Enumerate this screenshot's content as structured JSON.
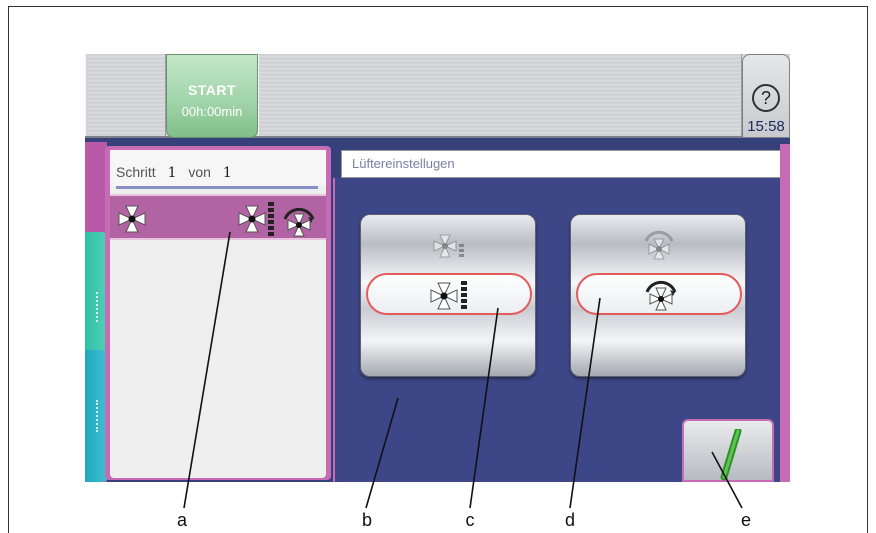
{
  "topbar": {
    "start_label": "START",
    "start_time": "00h:00min",
    "help_symbol": "?",
    "clock": "15:58"
  },
  "step_panel": {
    "schritt_word": "Schritt",
    "current": "1",
    "of_word": "von",
    "total": "1"
  },
  "settings": {
    "title": "Lüftereinstellugen"
  },
  "callouts": {
    "a": "a",
    "b": "b",
    "c": "c",
    "d": "d",
    "e": "e"
  },
  "colors": {
    "screen_bg": "#3d4787",
    "accent_pink": "#c56cb5",
    "start_green": "#9fd2a7",
    "pill_red": "#e25c5c",
    "confirm_green": "#3fae3a"
  },
  "icons": {
    "help": "question-icon",
    "fan": "fan-icon",
    "fan_speed": "fan-speed-bars-icon",
    "fan_direction": "fan-rotation-icon",
    "confirm": "checkmark-icon"
  }
}
